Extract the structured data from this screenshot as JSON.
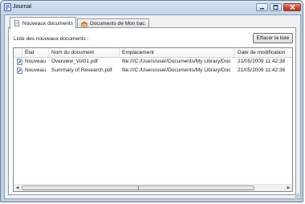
{
  "window": {
    "title": "Journal"
  },
  "tabs": [
    {
      "label": "Nouveaux documents",
      "icon": "new-documents-icon"
    },
    {
      "label": "Documents de Mon bac",
      "icon": "bin-documents-icon"
    }
  ],
  "panel": {
    "list_label": "Liste des nouveaux documents :",
    "clear_button": "Effacer la liste"
  },
  "table": {
    "columns": [
      "État",
      "Nom du document",
      "Emplacement",
      "Date de modification"
    ],
    "rows": [
      {
        "status": "Nouveau",
        "name": "Overview_Vol01.pdf",
        "location": "file:///C:/Users/user/Documents/My Library/Doc",
        "date": "21/05/2009 11:42:38"
      },
      {
        "status": "Nouveau",
        "name": "Summary of Research.pdf",
        "location": "file:///C:/Users/user/Documents/My Library/Doc",
        "date": "21/05/2009 11:42:38"
      }
    ]
  },
  "colors": {
    "title_bar": "#c2d6ee",
    "close_button": "#c5462b",
    "link_icon": "#2a4fb0"
  }
}
